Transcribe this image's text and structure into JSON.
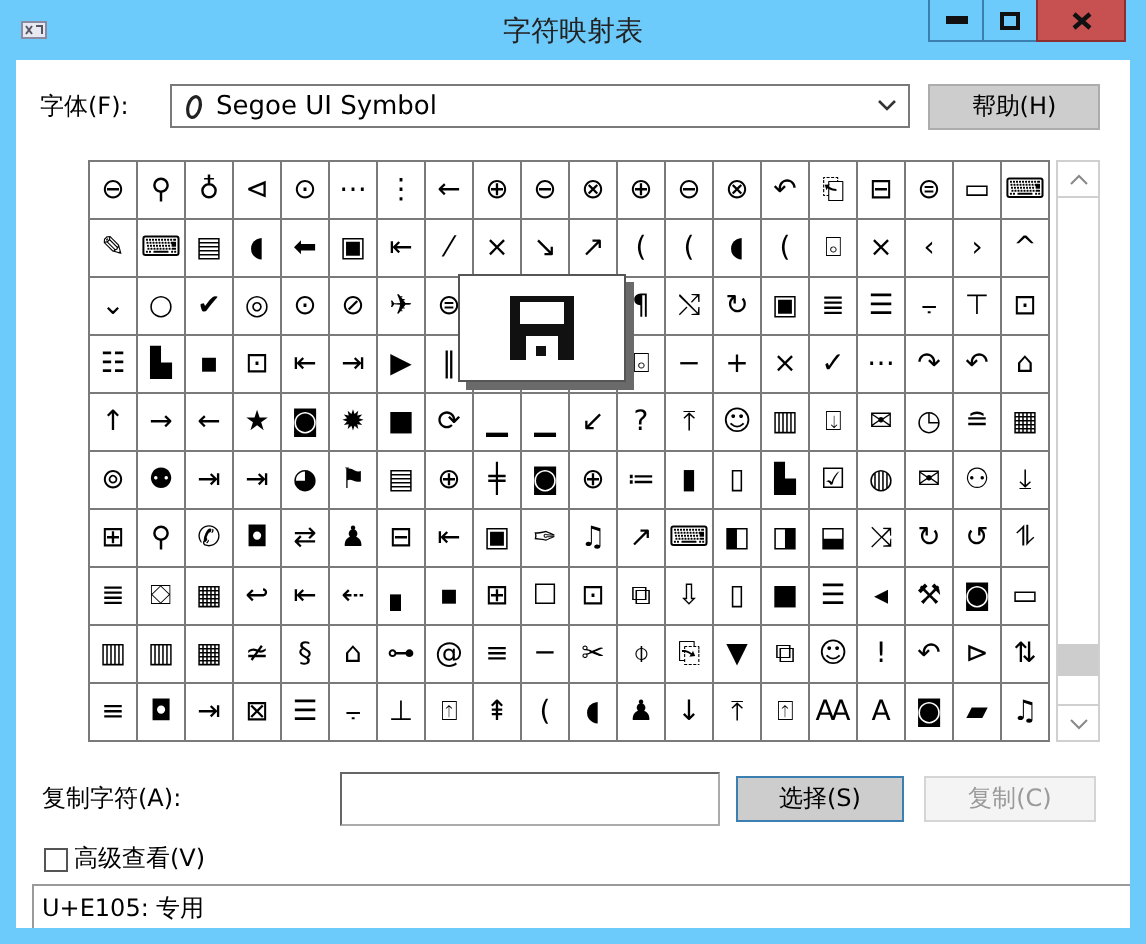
{
  "window": {
    "title": "字符映射表"
  },
  "font": {
    "label": "字体(F):",
    "value": "Segoe UI Symbol"
  },
  "help_button": {
    "label": "帮助(H)"
  },
  "grid": {
    "rows": [
      [
        "⊖",
        "⚲",
        "♁",
        "⊲",
        "⊙",
        "⋯",
        "⋮",
        "←",
        "⊕",
        "⊖",
        "⊗",
        "⊕",
        "⊖",
        "⊗",
        "↶",
        "⎗",
        "⊟",
        "⊜",
        "▭",
        "⌨"
      ],
      [
        "✎",
        "⌨",
        "▤",
        "◖",
        "⬅",
        "▣",
        "⇤",
        "⁄",
        "×",
        "↘",
        "↗",
        "(",
        "(",
        "◖",
        "(",
        "⌻",
        "×",
        "‹",
        "›",
        "^"
      ],
      [
        "⌄",
        "○",
        "✔",
        "◎",
        "⊙",
        "⊘",
        "✈",
        "⊜",
        null,
        null,
        null,
        "¶",
        "⤭",
        "↻",
        "▣",
        "≣",
        "☰",
        "⨪",
        "⊤",
        "⊡"
      ],
      [
        "☷",
        "▙",
        "▪",
        "⊡",
        "⇤",
        "⇥",
        "▶",
        "‖",
        null,
        null,
        null,
        "⌻",
        "−",
        "+",
        "×",
        "✓",
        "⋯",
        "↷",
        "↶",
        "⌂"
      ],
      [
        "↑",
        "→",
        "←",
        "★",
        "◙",
        "✹",
        "■",
        "⟳",
        "▁",
        "▁",
        "↙",
        "?",
        "⤒",
        "☺",
        "▥",
        "⍗",
        "✉",
        "◷",
        "≘",
        "▦"
      ],
      [
        "⊚",
        "⚉",
        "⇥",
        "⇥",
        "◕",
        "⚑",
        "▤",
        "⊕",
        "╪",
        "◙",
        "⊕",
        "≔",
        "▮",
        "▯",
        "▙",
        "☑",
        "◍",
        "✉",
        "⚇",
        "⤓"
      ],
      [
        "⊞",
        "⚲",
        "✆",
        "◘",
        "⇄",
        "♟",
        "⊟",
        "⇤",
        "▣",
        "✑",
        "♫",
        "↗",
        "⌨",
        "◧",
        "◨",
        "⬓",
        "⤨",
        "↻",
        "↺",
        "⥮"
      ],
      [
        "≣",
        "⛋",
        "▦",
        "↩",
        "⇤",
        "⇠",
        "▖",
        "▪",
        "⊞",
        "☐",
        "⊡",
        "⧉",
        "⇩",
        "▯",
        "■",
        "☰",
        "◂",
        "⚒",
        "◙",
        "▭"
      ],
      [
        "▥",
        "▥",
        "▦",
        "≄",
        "§",
        "⌂",
        "⊶",
        "@",
        "≡",
        "─",
        "✂",
        "⌽",
        "⎘",
        "▼",
        "⧉",
        "☺",
        "!",
        "↶",
        "⊳",
        "⇅"
      ],
      [
        "≡",
        "◘",
        "⇥",
        "⊠",
        "☰",
        "⨪",
        "⊥",
        "⍐",
        "⇞",
        "(",
        "◖",
        "♟",
        "↓",
        "⤒",
        "⍐",
        "Ꜳ",
        "A",
        "◙",
        "▰",
        "♫"
      ]
    ]
  },
  "copy": {
    "label": "复制字符(A):"
  },
  "select_button": {
    "label": "选择(S)",
    "default": true
  },
  "copy_button": {
    "label": "复制(C)",
    "disabled": true
  },
  "advanced_view": {
    "label": "高级查看(V)",
    "checked": false
  },
  "status_bar": "U+E105: 专用"
}
